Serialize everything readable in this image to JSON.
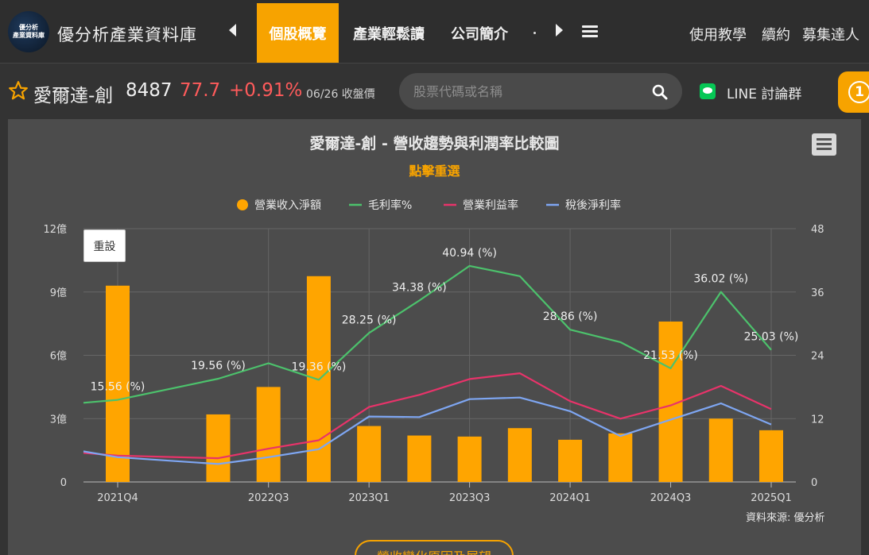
{
  "header": {
    "logo_text_line1": "優分析",
    "logo_text_line2": "產業資料庫",
    "brand": "優分析產業資料庫",
    "tabs": [
      "個股概覽",
      "產業輕鬆讀",
      "公司簡介"
    ],
    "links": [
      "使用教學",
      "續約",
      "募集達人"
    ],
    "icons": {
      "left": "chevron-left-icon",
      "right": "chevron-right-icon",
      "menu": "hamburger-menu-icon"
    }
  },
  "stock": {
    "name": "愛爾達-創",
    "code": "8487",
    "price": "77.7",
    "change": "+0.91%",
    "date_label": "06/26 收盤價"
  },
  "search": {
    "placeholder": "股票代碼或名稱"
  },
  "line_group": {
    "label": "LINE 討論群"
  },
  "notification": {
    "count": "1"
  },
  "chart_panel": {
    "reset_label": "重設",
    "subtitle": "點擊重選",
    "source": "資料來源: 優分析",
    "bottom_button": "營收變化原因及展望"
  },
  "colors": {
    "accent": "#f7a300",
    "bar": "#ffa500",
    "gross": "#4cc26c",
    "op": "#e8336a",
    "net": "#7ea6f2",
    "up": "#ff5b5b"
  },
  "chart_data": {
    "type": "bar",
    "title": "愛爾達-創 - 營收趨勢與利潤率比較圖",
    "x_ticks": [
      "2021Q4",
      "2022Q3",
      "2023Q1",
      "2023Q3",
      "2024Q1",
      "2024Q3",
      "2025Q1"
    ],
    "categories": [
      "2021Q4",
      "2022Q1",
      "2022Q2",
      "2022Q3",
      "2022Q4",
      "2023Q1",
      "2023Q2",
      "2023Q3",
      "2023Q4",
      "2024Q1",
      "2024Q2",
      "2024Q3",
      "2024Q4",
      "2025Q1"
    ],
    "y_left": {
      "ticks": [
        "0",
        "3億",
        "6億",
        "9億",
        "12億"
      ],
      "range": [
        0,
        12
      ],
      "unit": "億"
    },
    "y_right": {
      "ticks": [
        "0",
        "12",
        "24",
        "36",
        "48"
      ],
      "range": [
        0,
        48
      ]
    },
    "legend": [
      "營業收入淨額",
      "毛利率%",
      "營業利益率",
      "稅後淨利率"
    ],
    "legend_position": "top-center",
    "series": [
      {
        "name": "營業收入淨額",
        "type": "bar",
        "axis": "left",
        "values": [
          9.3,
          null,
          3.2,
          4.5,
          9.75,
          2.65,
          2.2,
          2.15,
          2.55,
          2.0,
          2.3,
          7.6,
          3.0,
          2.45
        ]
      },
      {
        "name": "毛利率%",
        "type": "line",
        "axis": "right",
        "values": [
          15.56,
          null,
          19.56,
          22.5,
          19.36,
          28.25,
          34.38,
          40.94,
          39.0,
          28.86,
          26.5,
          21.53,
          36.02,
          25.03
        ],
        "start_value": 15.0
      },
      {
        "name": "營業利益率",
        "type": "line",
        "axis": "right",
        "values": [
          5.0,
          null,
          4.5,
          6.3,
          7.9,
          14.2,
          16.5,
          19.5,
          20.6,
          15.3,
          12.0,
          14.5,
          18.2,
          13.8
        ],
        "start_value": 5.5
      },
      {
        "name": "稅後淨利率",
        "type": "line",
        "axis": "right",
        "values": [
          4.7,
          null,
          3.4,
          4.7,
          6.2,
          12.4,
          12.3,
          15.7,
          16.0,
          13.4,
          8.7,
          11.8,
          14.9,
          10.9
        ],
        "start_value": 5.8
      }
    ],
    "data_labels": [
      {
        "category": "2021Q4",
        "text": "15.56 (%)"
      },
      {
        "category": "2022Q2",
        "text": "19.56 (%)"
      },
      {
        "category": "2022Q4",
        "text": "19.36 (%)"
      },
      {
        "category": "2023Q1",
        "text": "28.25 (%)"
      },
      {
        "category": "2023Q2",
        "text": "34.38 (%)"
      },
      {
        "category": "2023Q3",
        "text": "40.94 (%)"
      },
      {
        "category": "2024Q1",
        "text": "28.86 (%)"
      },
      {
        "category": "2024Q3",
        "text": "21.53 (%)"
      },
      {
        "category": "2024Q4",
        "text": "36.02 (%)"
      },
      {
        "category": "2025Q1",
        "text": "25.03 (%)"
      }
    ],
    "grid": true
  }
}
